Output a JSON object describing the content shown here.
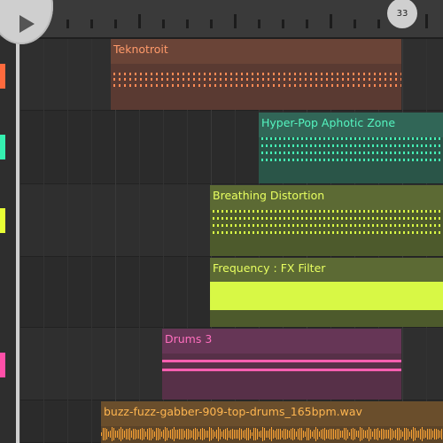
{
  "transport": {
    "play_icon": "play-icon",
    "bar_number": "33"
  },
  "tracks": [
    {
      "name": "track-1",
      "color": "#ff6a3d"
    },
    {
      "name": "track-2",
      "color": "#35f0b0"
    },
    {
      "name": "track-3",
      "color": "#e8ff35"
    },
    {
      "name": "track-4",
      "color": "#444444"
    },
    {
      "name": "track-5",
      "color": "#ff4fa8"
    },
    {
      "name": "track-6",
      "color": "#ff9a2e"
    }
  ],
  "clips": [
    {
      "label": "Teknotroit",
      "color": "#ff8a55",
      "type": "midi"
    },
    {
      "label": "Hyper-Pop Aphotic Zone",
      "color": "#45f0b5",
      "type": "midi"
    },
    {
      "label": "Breathing Distortion",
      "color": "#e0ff50",
      "type": "midi"
    },
    {
      "label": "Frequency : FX Filter",
      "color": "#e0ff50",
      "type": "automation"
    },
    {
      "label": "Drums 3",
      "color": "#ff5fb0",
      "type": "midi"
    },
    {
      "label": "buzz-fuzz-gabber-909-top-drums_165bpm.wav",
      "color": "#ffaa40",
      "type": "audio"
    }
  ]
}
